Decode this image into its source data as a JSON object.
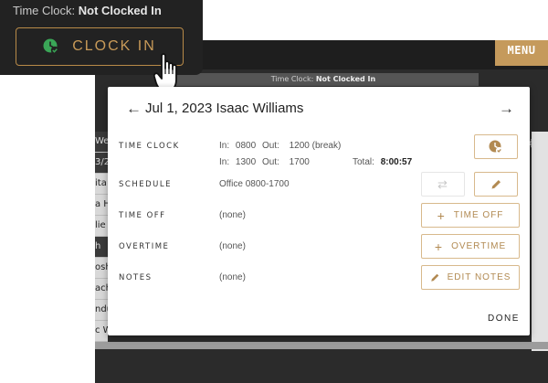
{
  "clock_widget": {
    "status_label": "Time Clock:",
    "status_value": "Not Clocked In",
    "clock_in_label": "CLOCK IN"
  },
  "background_app": {
    "menu_label": "MENU",
    "subheader_label": "Time Clock:",
    "subheader_value": "Not Clocked In",
    "side_rows": [
      "Wed",
      "3/2",
      "ita",
      "a H",
      "lie",
      "h",
      "osh",
      "ach",
      "ndu",
      "c W"
    ]
  },
  "modal": {
    "title": "Jul 1, 2023 Isaac Williams",
    "time_clock": {
      "label": "TIME CLOCK",
      "entries": [
        {
          "in_label": "In:",
          "in": "0800",
          "out_label": "Out:",
          "out": "1200 (break)"
        },
        {
          "in_label": "In:",
          "in": "1300",
          "out_label": "Out:",
          "out": "1700"
        }
      ],
      "total_label": "Total:",
      "total_value": "8:00:57"
    },
    "schedule": {
      "label": "SCHEDULE",
      "value": "Office 0800-1700"
    },
    "time_off": {
      "label": "TIME OFF",
      "value": "(none)",
      "button": "TIME OFF"
    },
    "overtime": {
      "label": "OVERTIME",
      "value": "(none)",
      "button": "OVERTIME"
    },
    "notes": {
      "label": "NOTES",
      "value": "(none)",
      "button": "EDIT NOTES"
    },
    "done_label": "DONE"
  },
  "colors": {
    "accent": "#c89a58",
    "clock_icon_green": "#3aa657",
    "dark_panel": "#222222"
  },
  "icons": [
    "arrow-left-icon",
    "arrow-right-icon",
    "clock-icon",
    "swap-icon",
    "pencil-icon",
    "plus-icon",
    "hand-cursor-icon",
    "gear-icon",
    "calendar-icon"
  ]
}
